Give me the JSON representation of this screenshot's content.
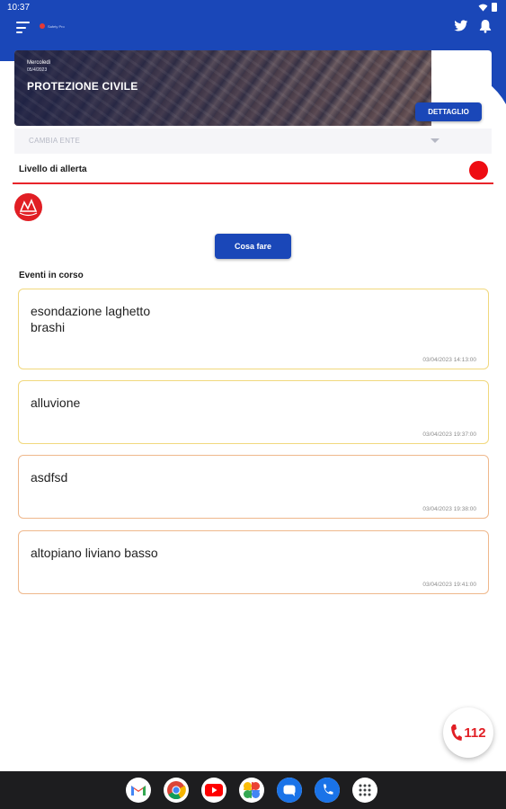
{
  "status_bar": {
    "time": "10:37"
  },
  "header": {
    "app_logo_text": "Safety Pro",
    "day": "Mercoledì",
    "date": "05/4/2023",
    "title": "PROTEZIONE CIVILE",
    "dettaglio_label": "DETTAGLIO"
  },
  "ente_select": {
    "label": "CAMBIA ENTE"
  },
  "alert": {
    "label": "Livello di allerta",
    "color": "#ee0c12"
  },
  "cosa_fare_label": "Cosa fare",
  "events": {
    "title": "Eventi in corso",
    "items": [
      {
        "name": "esondazione laghetto\nbrashi",
        "timestamp": "03/04/2023 14:13:00",
        "accent": "#f1d87d"
      },
      {
        "name": "alluvione",
        "timestamp": "03/04/2023 19:37:00",
        "accent": "#f1d87d"
      },
      {
        "name": "asdfsd",
        "timestamp": "03/04/2023 19:38:00",
        "accent": "#efb88c"
      },
      {
        "name": "altopiano liviano basso",
        "timestamp": "03/04/2023 19:41:00",
        "accent": "#efb88c"
      }
    ]
  },
  "emergency": {
    "number": "112"
  },
  "colors": {
    "primary": "#1a47b8",
    "alert_red": "#ee0c12"
  },
  "icons": [
    "menu-icon",
    "twitter-icon",
    "bell-icon",
    "wifi-icon",
    "battery-icon",
    "phone-icon",
    "gmail-icon",
    "chrome-icon",
    "youtube-icon",
    "photos-icon",
    "messages-icon",
    "phone-app-icon",
    "app-drawer-icon"
  ]
}
